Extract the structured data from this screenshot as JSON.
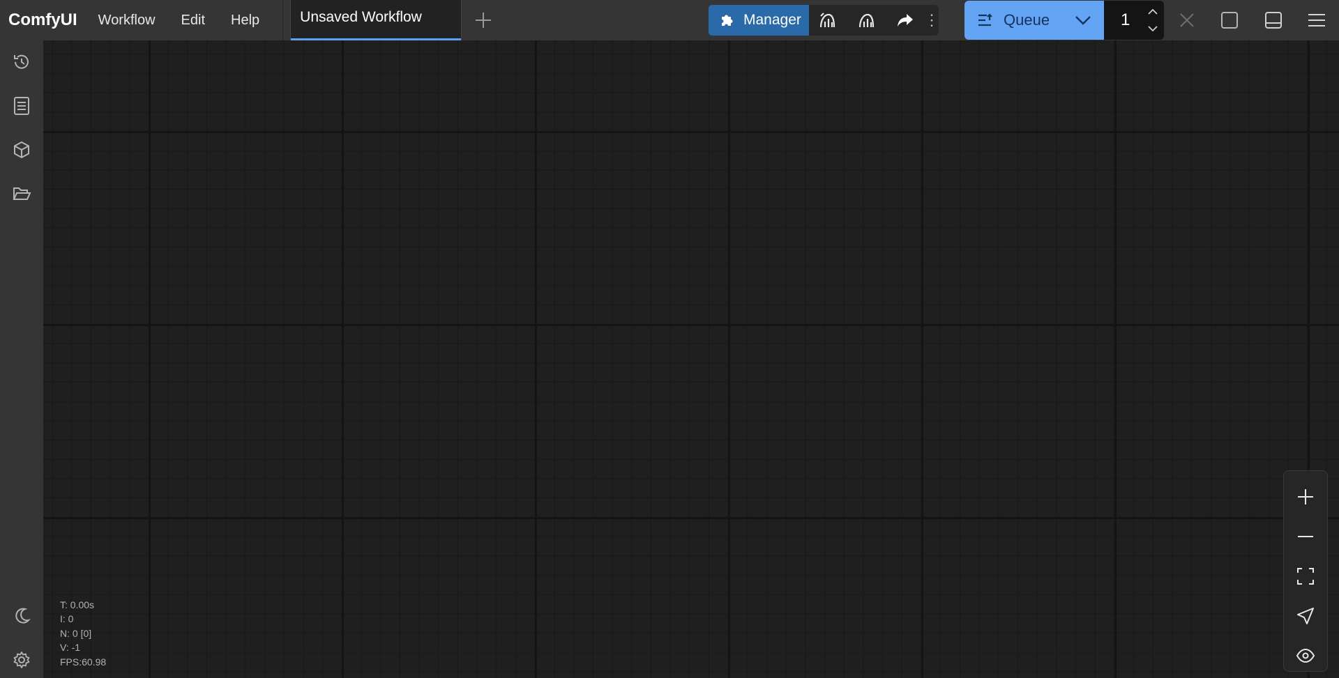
{
  "app": {
    "brand": "ComfyUI"
  },
  "menu": {
    "items": [
      "Workflow",
      "Edit",
      "Help"
    ]
  },
  "tabs": {
    "active_label": "Unsaved Workflow"
  },
  "actionbar": {
    "manager_label": "Manager"
  },
  "queue": {
    "label": "Queue",
    "batch_count": "1"
  },
  "stats": {
    "time": "T: 0.00s",
    "iterations": "I: 0",
    "nodes": "N: 0 [0]",
    "version": "V: -1",
    "fps": "FPS:60.98"
  },
  "colors": {
    "accent": "#5aa3f2",
    "queue_button": "#63a4f4",
    "manager_button": "#2a6aa8",
    "topbar": "#353535",
    "canvas": "#1f1f1f"
  },
  "icons": {
    "sidebar": [
      "history-icon",
      "node-library-icon",
      "model-library-icon",
      "workflows-folder-icon",
      "theme-moon-icon",
      "settings-gear-icon"
    ],
    "zoom_controls": [
      "zoom-in-icon",
      "zoom-out-icon",
      "fit-view-icon",
      "focus-mode-icon",
      "toggle-links-icon"
    ]
  }
}
